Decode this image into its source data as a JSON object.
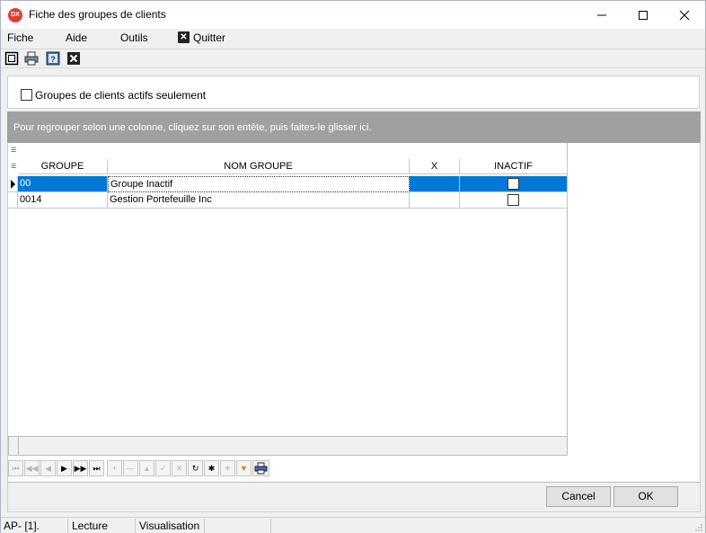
{
  "window": {
    "title": "Fiche des groupes de clients",
    "icon_text": "DX"
  },
  "menu": {
    "fiche": "Fiche",
    "aide": "Aide",
    "outils": "Outils",
    "quitter": "Quitter"
  },
  "filter": {
    "label": "Groupes de clients actifs seulement",
    "checked": false
  },
  "group_panel": {
    "text": "Pour regrouper selon une colonne, cliquez sur son entête, puis faites-le glisser ici."
  },
  "grid": {
    "columns": [
      "GROUPE",
      "NOM GROUPE",
      "X",
      "INACTIF"
    ],
    "rows": [
      {
        "groupe": "00",
        "nom": "Groupe Inactif",
        "x": "",
        "inactif": false
      },
      {
        "groupe": "0014",
        "nom": "Gestion Portefeuille Inc",
        "x": "",
        "inactif": false
      }
    ]
  },
  "buttons": {
    "cancel": "Cancel",
    "ok": "OK"
  },
  "status": {
    "left": "AP- [1].",
    "mode": "Lecture",
    "view": "Visualisation"
  },
  "colors": {
    "selection": "#0078d7",
    "group_panel": "#a0a0a0",
    "close_red": "#e23b33"
  }
}
